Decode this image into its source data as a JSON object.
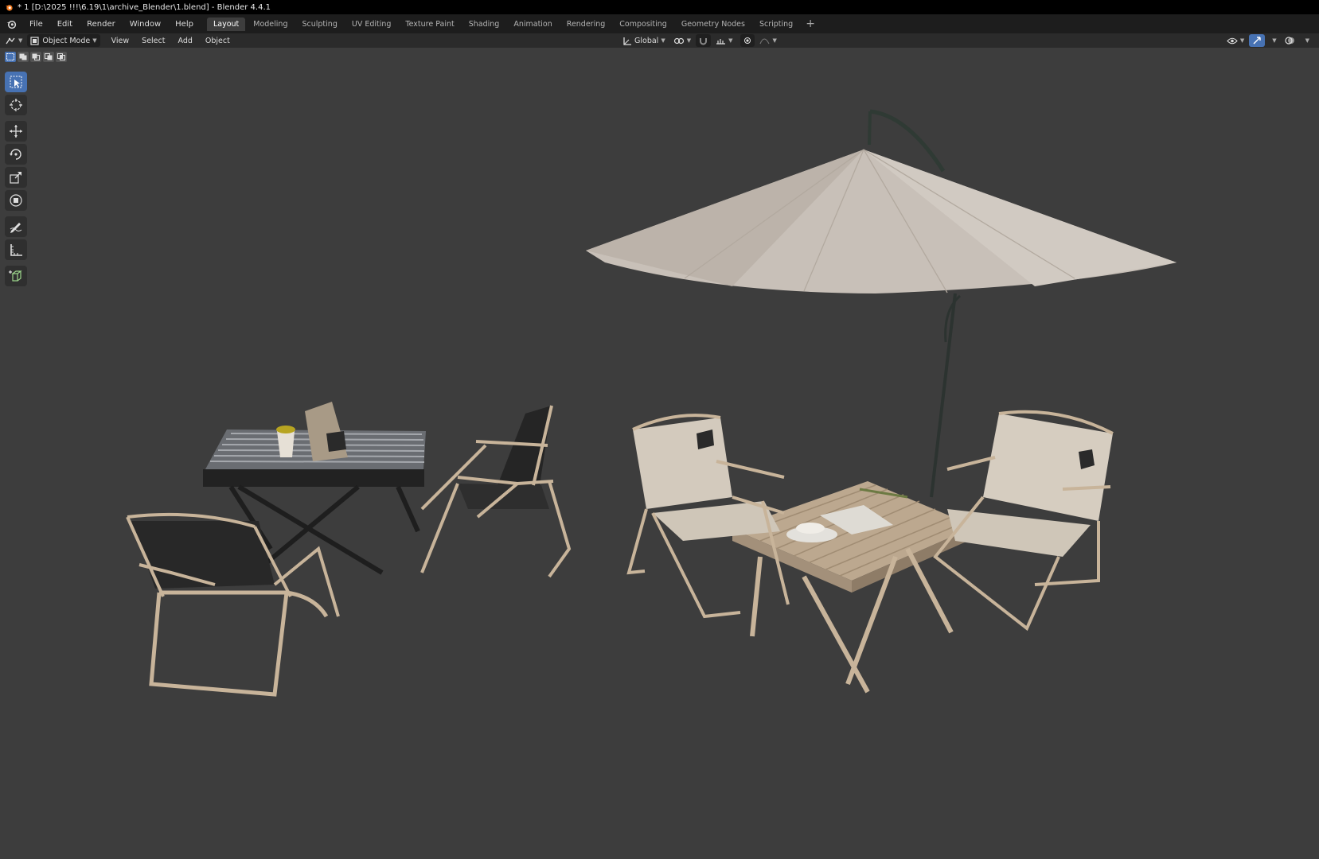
{
  "window": {
    "title": "* 1 [D:\\2025 !!!\\6.19\\1\\archive_Blender\\1.blend] - Blender 4.4.1"
  },
  "menubar": {
    "items": [
      "File",
      "Edit",
      "Render",
      "Window",
      "Help"
    ]
  },
  "workspaces": {
    "tabs": [
      "Layout",
      "Modeling",
      "Sculpting",
      "UV Editing",
      "Texture Paint",
      "Shading",
      "Animation",
      "Rendering",
      "Compositing",
      "Geometry Nodes",
      "Scripting"
    ],
    "active": "Layout",
    "add_label": "+"
  },
  "viewport_header": {
    "mode": "Object Mode",
    "menus": [
      "View",
      "Select",
      "Add",
      "Object"
    ],
    "transform_orientation": "Global"
  },
  "selection_modes": [
    "set",
    "extend",
    "subtract",
    "difference",
    "intersect"
  ],
  "tools": [
    {
      "icon": "select-box-icon",
      "active": true
    },
    {
      "icon": "cursor-icon",
      "active": false
    },
    {
      "icon": "move-icon",
      "active": false
    },
    {
      "icon": "rotate-icon",
      "active": false
    },
    {
      "icon": "scale-icon",
      "active": false
    },
    {
      "icon": "transform-icon",
      "active": false
    },
    {
      "icon": "annotate-icon",
      "active": false
    },
    {
      "icon": "measure-icon",
      "active": false
    },
    {
      "icon": "add-cube-icon",
      "active": false
    }
  ],
  "colors": {
    "viewport_bg": "#3d3d3d",
    "accent": "#4772b3",
    "umbrella_canopy": "#c9c1b9",
    "wood": "#c8b49a",
    "fabric_light": "#d6cdbf",
    "fabric_dark": "#2c2c2c"
  }
}
